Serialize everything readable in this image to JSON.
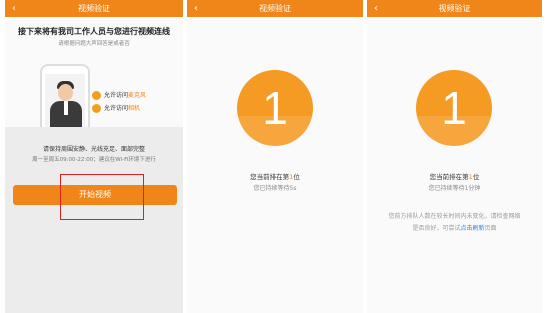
{
  "panel1": {
    "nav_title": "视频验证",
    "title": "接下来将有我司工作人员与您进行视频连线",
    "subtitle": "请根据问题大声回答是或者否",
    "permissions": [
      {
        "prefix": "允许访问",
        "item": "麦克风"
      },
      {
        "prefix": "允许访问",
        "item": "相机"
      }
    ],
    "tip1": "请保持周围安静、光线充足、面部完整",
    "tip2": "周一至周五09:00-22:00；建议在Wi-Fi环境下进行",
    "start_button": "开始视频"
  },
  "panel2": {
    "nav_title": "视频验证",
    "queue_number": "1",
    "rank_prefix": "您当前排在第",
    "rank_value": "1",
    "rank_suffix": "位",
    "wait_text": "您已持续等待5s"
  },
  "panel3": {
    "nav_title": "视频验证",
    "queue_number": "1",
    "rank_prefix": "您当前排在第",
    "rank_value": "1",
    "rank_suffix": "位",
    "wait_text": "您已持续等待1分钟",
    "note_line1": "您前方排队人数在较长时间内未变化，请检查网络",
    "note_line2_prefix": "是否良好，可尝试",
    "note_link": "点击刷新",
    "note_line2_suffix": "页面"
  },
  "colors": {
    "accent": "#f08519",
    "badge": "#f59a23",
    "link": "#2f7fd8",
    "highlight_box": "#e02020"
  },
  "icons": {
    "back": "chevron-left-icon",
    "permission": "circle-icon"
  }
}
